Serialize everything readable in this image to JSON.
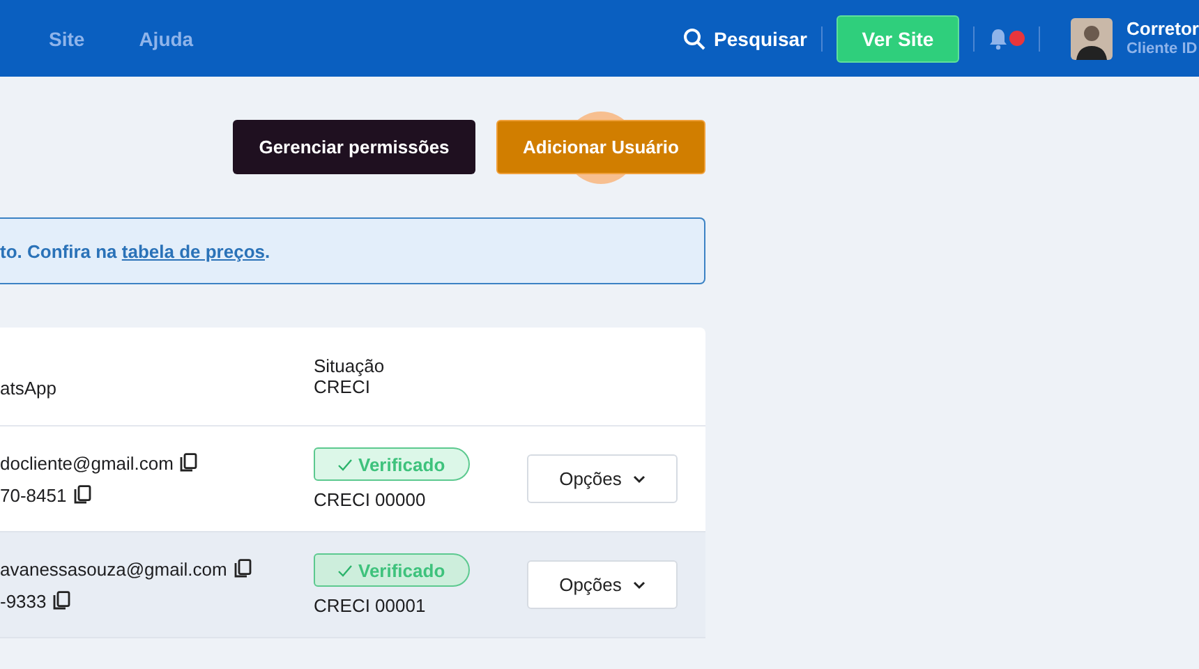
{
  "header": {
    "nav": [
      {
        "label": "Site"
      },
      {
        "label": "Ajuda"
      }
    ],
    "search": "Pesquisar",
    "view_site_button": "Ver Site",
    "notifications": {
      "unread": true
    },
    "user": {
      "name": "Corretor",
      "subtitle": "Cliente ID"
    }
  },
  "actions": [
    {
      "label": "Gerenciar permissões",
      "kind": "dark"
    },
    {
      "label": "Adicionar Usuário",
      "kind": "primary",
      "clicked": true
    }
  ],
  "notice": {
    "text": "to. Confira na ",
    "link": "tabela de preços",
    "after": "."
  },
  "table": {
    "columns": [
      "atsApp",
      "Situação CRECI"
    ],
    "rows": [
      {
        "email": "docliente@gmail.com",
        "phone": "70-8451",
        "status": "Verificado",
        "verified": true,
        "creci": "CRECI 00000",
        "action": "Opções",
        "highlighted": false
      },
      {
        "email": "avanessasouza@gmail.com",
        "phone": "-9333",
        "status": "Verificado",
        "verified": true,
        "creci": "CRECI 00001",
        "action": "Opções",
        "highlighted": true
      }
    ]
  }
}
